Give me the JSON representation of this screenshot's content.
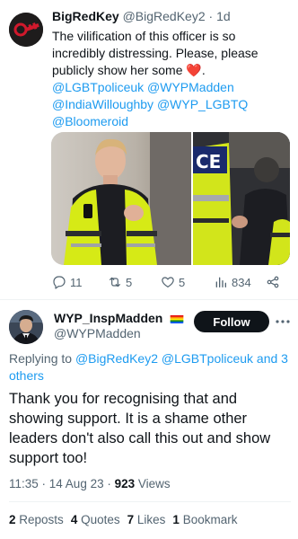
{
  "tweet1": {
    "author_name": "BigRedKey",
    "author_handle": "@BigRedKey2",
    "dot": "·",
    "time": "1d",
    "body_text": "The vilification of this officer is so incredibly distressing. Please, please publicly show her some",
    "body_emoji": "❤️",
    "body_end": ".",
    "mentions": [
      "@LGBTpoliceuk",
      "@WYPMadden",
      "@IndiaWilloughby",
      "@WYP_LGBTQ",
      "@Bloomeroid"
    ],
    "replies": "11",
    "retweets": "5",
    "likes": "5",
    "views": "834",
    "icons": [
      "reply-icon",
      "retweet-icon",
      "like-icon",
      "views-icon",
      "share-icon"
    ]
  },
  "tweet2": {
    "author_name": "WYP_InspMadden",
    "author_handle": "@WYPMadden",
    "badge_icon": "rainbow-flag-icon",
    "follow_label": "Follow",
    "replying_prefix": "Replying to",
    "replying_handles": [
      "@BigRedKey2",
      "@LGBTpoliceuk"
    ],
    "replying_and": "and",
    "replying_others": "3 others",
    "body": "Thank you for recognising that and showing support. It is a shame other leaders don't also call this out and show support too!",
    "time": "11:35",
    "date": "14 Aug 23",
    "views_count": "923",
    "views_label": "Views",
    "stats": {
      "reposts_count": "2",
      "reposts_label": "Reposts",
      "quotes_count": "4",
      "quotes_label": "Quotes",
      "likes_count": "7",
      "likes_label": "Likes",
      "bookmarks_count": "1",
      "bookmarks_label": "Bookmark"
    }
  },
  "colors": {
    "text": "#0f1419",
    "secondary": "#536471",
    "link": "#1d9bf0",
    "follow_bg": "#0f1419",
    "heart": "#e0112b"
  }
}
